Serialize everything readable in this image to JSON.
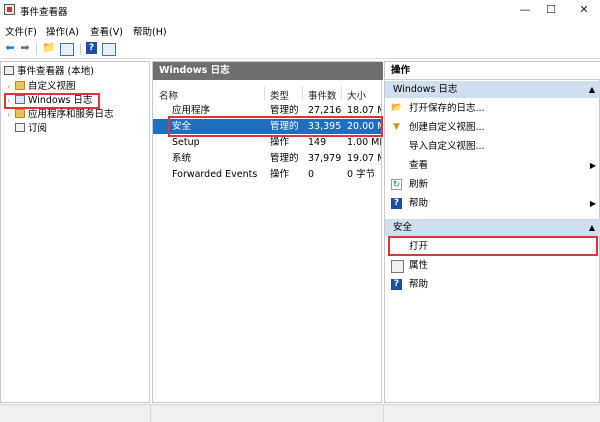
{
  "window": {
    "title": "事件查看器",
    "minimize": "—",
    "maximize": "☐",
    "close": "✕"
  },
  "menu": [
    "文件(F)",
    "操作(A)",
    "查看(V)",
    "帮助(H)"
  ],
  "tree": {
    "root": "事件查看器 (本地)",
    "items": [
      "自定义视图",
      "Windows 日志",
      "应用程序和服务日志",
      "订阅"
    ]
  },
  "center": {
    "header": "Windows 日志",
    "columns": [
      "名称",
      "类型",
      "事件数",
      "大小"
    ],
    "rows": [
      {
        "name": "应用程序",
        "type": "管理的",
        "count": "27,216",
        "size": "18.07 M"
      },
      {
        "name": "安全",
        "type": "管理的",
        "count": "33,395",
        "size": "20.00 M"
      },
      {
        "name": "Setup",
        "type": "操作",
        "count": "149",
        "size": "1.00 MB"
      },
      {
        "name": "系统",
        "type": "管理的",
        "count": "37,979",
        "size": "19.07 M"
      },
      {
        "name": "Forwarded Events",
        "type": "操作",
        "count": "0",
        "size": "0 字节"
      }
    ]
  },
  "actions": {
    "header": "操作",
    "section1": "Windows 日志",
    "section1_items": [
      "打开保存的日志...",
      "创建自定义视图...",
      "导入自定义视图...",
      "查看",
      "刷新",
      "帮助"
    ],
    "section2": "安全",
    "section2_items": [
      "打开",
      "属性",
      "帮助"
    ]
  },
  "colors": {
    "selection": "#1f6fbf",
    "highlight": "#e0343b",
    "section": "#cfdfef",
    "pane_header": "#6f6f6f"
  }
}
